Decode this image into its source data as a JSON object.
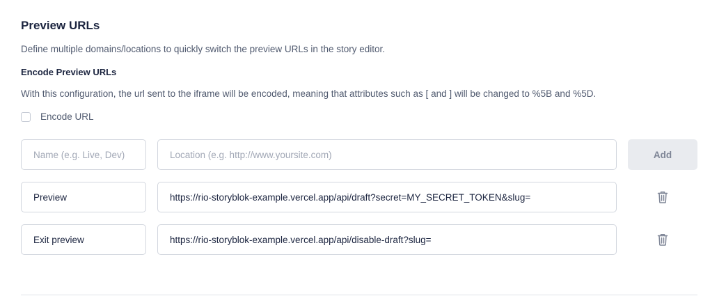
{
  "section": {
    "title": "Preview URLs",
    "description": "Define multiple domains/locations to quickly switch the preview URLs in the story editor.",
    "encode_title": "Encode Preview URLs",
    "encode_description": "With this configuration, the url sent to the iframe will be encoded, meaning that attributes such as [ and ] will be changed to %5B and %5D.",
    "encode_checkbox_label": "Encode URL",
    "encode_checked": false
  },
  "new_entry": {
    "name_placeholder": "Name (e.g. Live, Dev)",
    "location_placeholder": "Location (e.g. http://www.yoursite.com)",
    "add_label": "Add"
  },
  "entries": [
    {
      "name": "Preview",
      "location": "https://rio-storyblok-example.vercel.app/api/draft?secret=MY_SECRET_TOKEN&slug=",
      "delete_icon": "trash-icon"
    },
    {
      "name": "Exit preview",
      "location": "https://rio-storyblok-example.vercel.app/api/disable-draft?slug=",
      "delete_icon": "trash-icon"
    }
  ],
  "colors": {
    "heading": "#1b243f",
    "body_text": "#505a6f",
    "placeholder": "#a1a7b5",
    "border": "#d2d6de",
    "add_button_bg": "#e9ebef",
    "add_button_text": "#7e8596",
    "icon": "#7e8596"
  }
}
